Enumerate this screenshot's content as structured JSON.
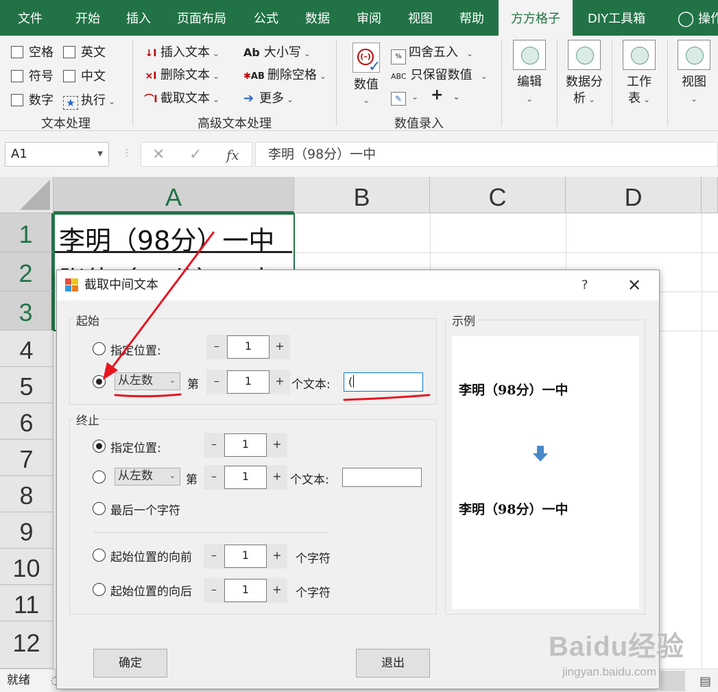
{
  "ribbon_tabs": [
    "文件",
    "开始",
    "插入",
    "页面布局",
    "公式",
    "数据",
    "审阅",
    "视图",
    "帮助",
    "方方格子",
    "DIY工具箱",
    "操作"
  ],
  "ribbon": {
    "text_group": {
      "label": "文本处理",
      "items": [
        "空格",
        "英文",
        "符号",
        "中文",
        "数字",
        "执行"
      ]
    },
    "advanced_group": {
      "label": "高级文本处理",
      "insert_text": "插入文本",
      "delete_text": "删除文本",
      "extract_text": "截取文本",
      "case": "大小写",
      "delete_spaces": "删除空格",
      "more": "更多"
    },
    "number_group": {
      "label": "数值录入",
      "number": "数值",
      "round": "四舍五入",
      "keep_value": "只保留数值",
      "plus": "+"
    },
    "big_buttons": {
      "edit": "编辑",
      "data_analysis_1": "数据分",
      "data_analysis_2": "析",
      "worksheet_1": "工作",
      "worksheet_2": "表",
      "view": "视图"
    }
  },
  "formula_bar": {
    "name_box": "A1",
    "fx": "fx",
    "formula": "李明（98分）一中"
  },
  "sheet": {
    "columns": [
      "A",
      "B",
      "C",
      "D"
    ],
    "rows": [
      "1",
      "2",
      "3",
      "4",
      "5",
      "6",
      "7",
      "8",
      "9",
      "10",
      "11",
      "12"
    ],
    "cells": {
      "A1": "李明（98分）一中",
      "A2": "张佳（90分）二中"
    }
  },
  "status_bar": {
    "ready": "就绪"
  },
  "dialog": {
    "title": "截取中间文本",
    "help": "?",
    "start": {
      "legend": "起始",
      "specified_position_label": "指定位置:",
      "specified_position_value": "1",
      "from_mode": "从左数",
      "nth_label": "第",
      "nth_value": "1",
      "text_label": "个文本:",
      "text_value": "("
    },
    "end": {
      "legend": "终止",
      "specified_position_label": "指定位置:",
      "specified_position_value": "1",
      "from_mode": "从左数",
      "nth_label": "第",
      "nth_value": "1",
      "text_label": "个文本:",
      "text_value": "",
      "last_char_label": "最后一个字符",
      "forward_label": "起始位置的向前",
      "forward_value": "1",
      "forward_unit": "个字符",
      "backward_label": "起始位置的向后",
      "backward_value": "1",
      "backward_unit": "个字符"
    },
    "example": {
      "legend": "示例",
      "before": "李明（98分）一中",
      "after": "李明（98分）一中"
    },
    "ok_button": "确定",
    "exit_button": "退出"
  },
  "watermark": {
    "main": "Baidu经验",
    "sub": "jingyan.baidu.com"
  },
  "colors": {
    "excel_green": "#217346",
    "annotation_red": "#e8141e",
    "arrow_blue": "#4a89c8"
  }
}
